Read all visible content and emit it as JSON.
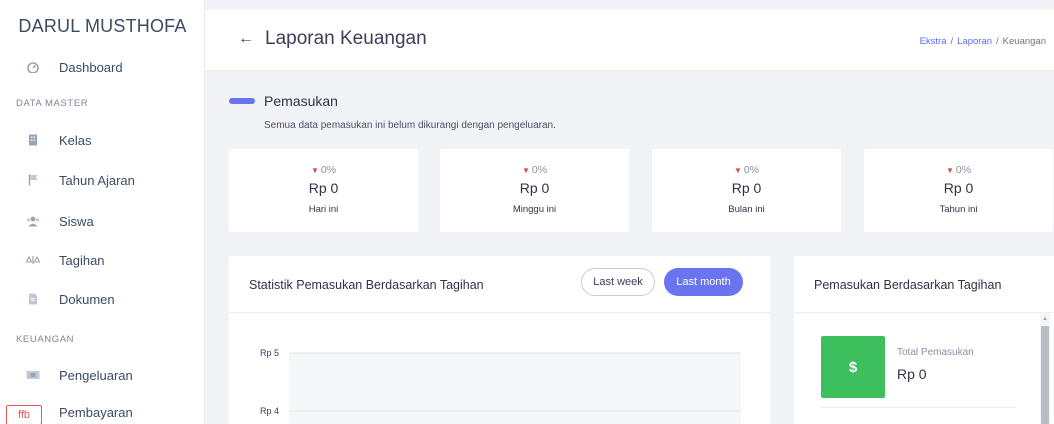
{
  "sidebar": {
    "brand": "DARUL MUSTHOFA",
    "dashboard": "Dashboard",
    "section_master": "DATA MASTER",
    "items_master": [
      {
        "label": "Kelas",
        "icon": "building-icon"
      },
      {
        "label": "Tahun Ajaran",
        "icon": "flag-icon"
      },
      {
        "label": "Siswa",
        "icon": "users-icon"
      },
      {
        "label": "Tagihan",
        "icon": "scale-icon"
      },
      {
        "label": "Dokumen",
        "icon": "document-icon"
      }
    ],
    "section_finance": "KEUANGAN",
    "items_finance": [
      {
        "label": "Pengeluaran",
        "icon": "wallet-icon"
      },
      {
        "label": "Pembayaran",
        "icon": "card-icon"
      }
    ],
    "badge": "ffb"
  },
  "header": {
    "back": "←",
    "title": "Laporan Keuangan",
    "breadcrumb": [
      "Ekstra",
      "Laporan",
      "Keuangan"
    ]
  },
  "income": {
    "title": "Pemasukan",
    "subtitle": "Semua data pemasukan ini belum dikurangi dengan pengeluaran.",
    "stats": [
      {
        "pct": "0%",
        "value": "Rp 0",
        "label": "Hari ini"
      },
      {
        "pct": "0%",
        "value": "Rp 0",
        "label": "Minggu ini"
      },
      {
        "pct": "0%",
        "value": "Rp 0",
        "label": "Bulan ini"
      },
      {
        "pct": "0%",
        "value": "Rp 0",
        "label": "Tahun ini"
      }
    ]
  },
  "chart_card": {
    "title": "Statistik Pemasukan Berdasarkan Tagihan",
    "btn_week": "Last week",
    "btn_month": "Last month",
    "accent": "#6a74f0"
  },
  "chart_data": {
    "type": "area",
    "title": "",
    "y_ticks": [
      "Rp 5",
      "Rp 4"
    ],
    "ylim": [
      4,
      5
    ],
    "grid": true
  },
  "right_card": {
    "title": "Pemasukan Berdasarkan Tagihan",
    "icon_symbol": "$",
    "total_label": "Total Pemasukan",
    "total_value": "Rp 0",
    "icon_color": "#3dbf5e"
  }
}
